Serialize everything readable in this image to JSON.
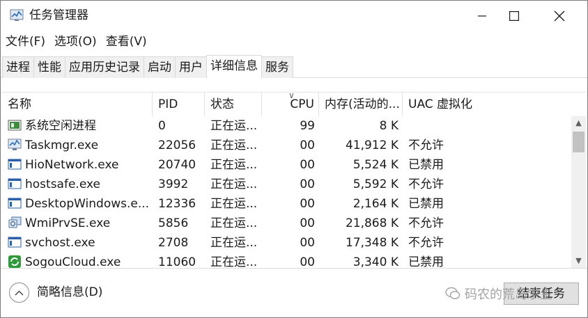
{
  "window": {
    "title": "任务管理器"
  },
  "menu": [
    "文件(F)",
    "选项(O)",
    "查看(V)"
  ],
  "tabs": [
    {
      "label": "进程",
      "active": false
    },
    {
      "label": "性能",
      "active": false
    },
    {
      "label": "应用历史记录",
      "active": false
    },
    {
      "label": "启动",
      "active": false
    },
    {
      "label": "用户",
      "active": false
    },
    {
      "label": "详细信息",
      "active": true
    },
    {
      "label": "服务",
      "active": false
    }
  ],
  "table": {
    "columns": {
      "name": "名称",
      "pid": "PID",
      "status": "状态",
      "cpu": "CPU",
      "mem": "内存(活动的...",
      "uac": "UAC 虚拟化"
    },
    "rows": [
      {
        "icon": "system-idle-icon",
        "name": "系统空闲进程",
        "pid": "0",
        "status": "正在运...",
        "cpu": "99",
        "mem": "8 K",
        "uac": ""
      },
      {
        "icon": "taskmgr-icon",
        "name": "Taskmgr.exe",
        "pid": "22056",
        "status": "正在运...",
        "cpu": "00",
        "mem": "41,912 K",
        "uac": "不允许"
      },
      {
        "icon": "window-app-icon",
        "name": "HioNetwork.exe",
        "pid": "20740",
        "status": "正在运...",
        "cpu": "00",
        "mem": "5,524 K",
        "uac": "已禁用"
      },
      {
        "icon": "window-app-icon",
        "name": "hostsafe.exe",
        "pid": "3992",
        "status": "正在运...",
        "cpu": "00",
        "mem": "5,592 K",
        "uac": "不允许"
      },
      {
        "icon": "window-app-icon",
        "name": "DesktopWindows.e...",
        "pid": "12336",
        "status": "正在运...",
        "cpu": "00",
        "mem": "2,164 K",
        "uac": "已禁用"
      },
      {
        "icon": "wmi-icon",
        "name": "WmiPrvSE.exe",
        "pid": "5856",
        "status": "正在运...",
        "cpu": "00",
        "mem": "21,868 K",
        "uac": "不允许"
      },
      {
        "icon": "window-app-icon",
        "name": "svchost.exe",
        "pid": "2708",
        "status": "正在运...",
        "cpu": "00",
        "mem": "17,348 K",
        "uac": "不允许"
      },
      {
        "icon": "sogou-cloud-icon",
        "name": "SogouCloud.exe",
        "pid": "11060",
        "status": "正在运...",
        "cpu": "00",
        "mem": "3,340 K",
        "uac": "已禁用"
      }
    ]
  },
  "footer": {
    "fewer_details": "简略信息(D)",
    "end_task": "结束任务",
    "watermark": "码农的荒岛求生"
  },
  "colors": {
    "accent": "#0066b8",
    "sogou_green": "#2e9a3a"
  }
}
